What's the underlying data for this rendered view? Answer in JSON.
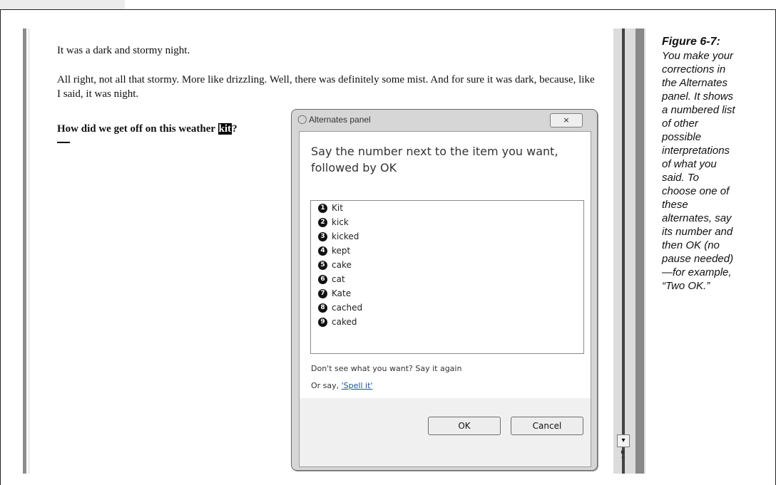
{
  "document": {
    "line1": "It was a dark and stormy night.",
    "line2": "All right, not all that stormy.  More like drizzling.  Well, there was definitely some mist. And for sure it was dark, because, like I said, it was night.",
    "line3_before": "How did we get off on this weather ",
    "line3_highlight": "kit",
    "line3_after": "?"
  },
  "dialog": {
    "title": "Alternates panel",
    "close_label": "×",
    "prompt": "Say the number next to the item you want, followed by OK",
    "items": [
      {
        "num": "1",
        "label": "Kit"
      },
      {
        "num": "2",
        "label": "kick"
      },
      {
        "num": "3",
        "label": "kicked"
      },
      {
        "num": "4",
        "label": "kept"
      },
      {
        "num": "5",
        "label": "cake"
      },
      {
        "num": "6",
        "label": "cat"
      },
      {
        "num": "7",
        "label": "Kate"
      },
      {
        "num": "8",
        "label": "cached"
      },
      {
        "num": "9",
        "label": "caked"
      }
    ],
    "hint_again": "Don't see what you want? Say it again",
    "hint_spell_prefix": "Or say, ",
    "hint_spell_link": "'Spell it'",
    "ok_label": "OK",
    "cancel_label": "Cancel"
  },
  "caption": {
    "title": "Figure 6-7:",
    "text": "You make your corrections in the Alternates panel. It shows a numbered list of other possible interpretations of what you said. To choose one of these alternates, say its number and then OK (no pause needed)—for example, “Two OK.”"
  },
  "icons": {
    "mic": "microphone-icon",
    "close": "close-icon",
    "scroll_down": "scroll-down-arrow-icon"
  }
}
